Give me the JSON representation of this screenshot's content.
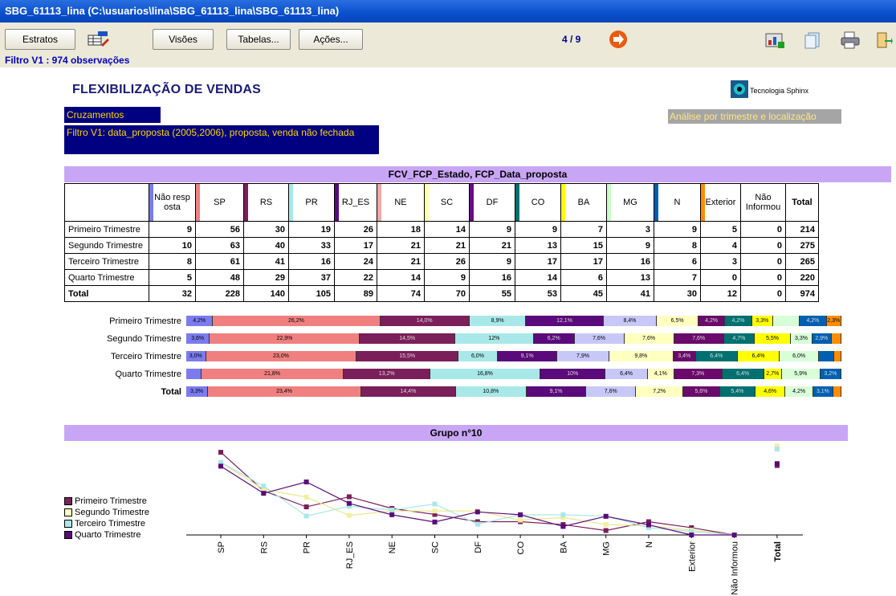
{
  "window": {
    "title": "SBG_61113_lina (C:\\usuarios\\lina\\SBG_61113_lina\\SBG_61113_lina)"
  },
  "toolbar": {
    "estratos_label": "Estratos",
    "visoes_label": "Visões",
    "tabelas_label": "Tabelas...",
    "acoes_label": "Ações...",
    "pager": "4 / 9",
    "filter_status": "Filtro V1 : 974 observações"
  },
  "header": {
    "title": "FLEXIBILIZAÇÃO DE VENDAS",
    "logo_text": "Tecnologia Sphinx",
    "cruzamentos": "Cruzamentos",
    "filter_desc": "Filtro V1: data_proposta (2005,2006), proposta, venda não fechada",
    "analysis": "Análise por trimestre e localização"
  },
  "table": {
    "title": "FCV_FCP_Estado, FCP_Data_proposta",
    "columns": [
      "Não resp osta",
      "SP",
      "RS",
      "PR",
      "RJ_ES",
      "NE",
      "SC",
      "DF",
      "CO",
      "BA",
      "MG",
      "N",
      "Exterior",
      "Não Informou",
      "Total"
    ],
    "column_colors": [
      "#7b7bef",
      "#f08080",
      "#7a1f5a",
      "#a8e8e8",
      "#5a0a7a",
      "#f0a8a8",
      "#ffffb0",
      "#6a0a8a",
      "#007070",
      "#ffff00",
      "#c8ffc8",
      "#0060b0",
      "#ff8c00",
      "",
      ""
    ],
    "rows": [
      {
        "label": "Primeiro Trimestre",
        "values": [
          "9",
          "56",
          "30",
          "19",
          "26",
          "18",
          "14",
          "9",
          "9",
          "7",
          "3",
          "9",
          "5",
          "0",
          "214"
        ]
      },
      {
        "label": "Segundo Trimestre",
        "values": [
          "10",
          "63",
          "40",
          "33",
          "17",
          "21",
          "21",
          "21",
          "13",
          "15",
          "9",
          "8",
          "4",
          "0",
          "275"
        ]
      },
      {
        "label": "Terceiro Trimestre",
        "values": [
          "8",
          "61",
          "41",
          "16",
          "24",
          "21",
          "26",
          "9",
          "17",
          "17",
          "16",
          "6",
          "3",
          "0",
          "265"
        ]
      },
      {
        "label": "Quarto Trimestre",
        "values": [
          "5",
          "48",
          "29",
          "37",
          "22",
          "14",
          "9",
          "16",
          "14",
          "6",
          "13",
          "7",
          "0",
          "0",
          "220"
        ]
      },
      {
        "label": "Total",
        "values": [
          "32",
          "228",
          "140",
          "105",
          "89",
          "74",
          "70",
          "55",
          "53",
          "45",
          "41",
          "30",
          "12",
          "0",
          "974"
        ]
      }
    ]
  },
  "stacked": {
    "rows": [
      {
        "label": "Primeiro Trimestre",
        "segments": [
          {
            "c": "#7b7bef",
            "v": 4.2,
            "t": "4,2%"
          },
          {
            "c": "#f08080",
            "v": 26.2,
            "t": "26,2%"
          },
          {
            "c": "#7a1f5a",
            "v": 14.0,
            "t": "14,0%"
          },
          {
            "c": "#a8e8e8",
            "v": 8.9,
            "t": "8,9%"
          },
          {
            "c": "#5a0a7a",
            "v": 12.1,
            "t": "12,1%"
          },
          {
            "c": "#c8c8f8",
            "v": 8.4,
            "t": "8,4%"
          },
          {
            "c": "#ffffc0",
            "v": 6.5,
            "t": "6,5%"
          },
          {
            "c": "#6a0a6a",
            "v": 4.2,
            "t": "4,2%"
          },
          {
            "c": "#007070",
            "v": 4.2,
            "t": "4,2%"
          },
          {
            "c": "#ffff00",
            "v": 3.3,
            "t": "3,3%"
          },
          {
            "c": "#d8ffd8",
            "v": 4.2,
            "t": ""
          },
          {
            "c": "#0060b0",
            "v": 4.2,
            "t": "4,2%"
          },
          {
            "c": "#ff8c00",
            "v": 2.3,
            "t": "2,3%"
          }
        ]
      },
      {
        "label": "Segundo Trimestre",
        "segments": [
          {
            "c": "#7b7bef",
            "v": 3.6,
            "t": "3,6%"
          },
          {
            "c": "#f08080",
            "v": 22.9,
            "t": "22,9%"
          },
          {
            "c": "#7a1f5a",
            "v": 14.5,
            "t": "14,5%"
          },
          {
            "c": "#a8e8e8",
            "v": 12.0,
            "t": "12%"
          },
          {
            "c": "#5a0a7a",
            "v": 6.2,
            "t": "6,2%"
          },
          {
            "c": "#c8c8f8",
            "v": 7.6,
            "t": "7,6%"
          },
          {
            "c": "#ffffc0",
            "v": 7.6,
            "t": "7,6%"
          },
          {
            "c": "#6a0a6a",
            "v": 7.6,
            "t": "7,6%"
          },
          {
            "c": "#007070",
            "v": 4.7,
            "t": "4,7%"
          },
          {
            "c": "#ffff00",
            "v": 5.5,
            "t": "5,5%"
          },
          {
            "c": "#d8ffd8",
            "v": 3.3,
            "t": "3,3%"
          },
          {
            "c": "#0060b0",
            "v": 2.9,
            "t": "2,9%"
          },
          {
            "c": "#ff8c00",
            "v": 1.5,
            "t": ""
          }
        ]
      },
      {
        "label": "Terceiro Trimestre",
        "segments": [
          {
            "c": "#7b7bef",
            "v": 3.0,
            "t": "3,0%"
          },
          {
            "c": "#f08080",
            "v": 23.0,
            "t": "23,0%"
          },
          {
            "c": "#7a1f5a",
            "v": 15.5,
            "t": "15,5%"
          },
          {
            "c": "#a8e8e8",
            "v": 6.0,
            "t": "6,0%"
          },
          {
            "c": "#5a0a7a",
            "v": 9.1,
            "t": "9,1%"
          },
          {
            "c": "#c8c8f8",
            "v": 7.9,
            "t": "7,9%"
          },
          {
            "c": "#ffffc0",
            "v": 9.8,
            "t": "9,8%"
          },
          {
            "c": "#6a0a6a",
            "v": 3.4,
            "t": "3,4%"
          },
          {
            "c": "#007070",
            "v": 6.4,
            "t": "6,4%"
          },
          {
            "c": "#ffff00",
            "v": 6.4,
            "t": "6,4%"
          },
          {
            "c": "#d8ffd8",
            "v": 6.0,
            "t": "6,0%"
          },
          {
            "c": "#0060b0",
            "v": 2.3,
            "t": ""
          },
          {
            "c": "#ff8c00",
            "v": 1.1,
            "t": ""
          }
        ]
      },
      {
        "label": "Quarto Trimestre",
        "segments": [
          {
            "c": "#7b7bef",
            "v": 2.3,
            "t": ""
          },
          {
            "c": "#f08080",
            "v": 21.8,
            "t": "21,8%"
          },
          {
            "c": "#7a1f5a",
            "v": 13.2,
            "t": "13,2%"
          },
          {
            "c": "#a8e8e8",
            "v": 16.8,
            "t": "16,8%"
          },
          {
            "c": "#5a0a7a",
            "v": 10.0,
            "t": "10%"
          },
          {
            "c": "#c8c8f8",
            "v": 6.4,
            "t": "6,4%"
          },
          {
            "c": "#ffffc0",
            "v": 4.1,
            "t": "4,1%"
          },
          {
            "c": "#6a0a6a",
            "v": 7.3,
            "t": "7,3%"
          },
          {
            "c": "#007070",
            "v": 6.4,
            "t": "6,4%"
          },
          {
            "c": "#ffff00",
            "v": 2.7,
            "t": "2,7%"
          },
          {
            "c": "#d8ffd8",
            "v": 5.9,
            "t": "5,9%"
          },
          {
            "c": "#0060b0",
            "v": 3.2,
            "t": "3,2%"
          }
        ]
      },
      {
        "label": "Total",
        "segments": [
          {
            "c": "#7b7bef",
            "v": 3.3,
            "t": "3,3%"
          },
          {
            "c": "#f08080",
            "v": 23.4,
            "t": "23,4%"
          },
          {
            "c": "#7a1f5a",
            "v": 14.4,
            "t": "14,4%"
          },
          {
            "c": "#a8e8e8",
            "v": 10.8,
            "t": "10,8%"
          },
          {
            "c": "#5a0a7a",
            "v": 9.1,
            "t": "9,1%"
          },
          {
            "c": "#c8c8f8",
            "v": 7.6,
            "t": "7,6%"
          },
          {
            "c": "#ffffc0",
            "v": 7.2,
            "t": "7,2%"
          },
          {
            "c": "#6a0a6a",
            "v": 5.6,
            "t": "5,6%"
          },
          {
            "c": "#007070",
            "v": 5.4,
            "t": "5,4%"
          },
          {
            "c": "#ffff00",
            "v": 4.6,
            "t": "4,6%"
          },
          {
            "c": "#d8ffd8",
            "v": 4.2,
            "t": "4,2%"
          },
          {
            "c": "#0060b0",
            "v": 3.1,
            "t": "3,1%"
          },
          {
            "c": "#ff8c00",
            "v": 1.2,
            "t": ""
          }
        ]
      }
    ]
  },
  "chart_data": {
    "type": "line",
    "title": "Grupo n°10",
    "categories": [
      "SP",
      "RS",
      "PR",
      "RJ_ES",
      "NE",
      "SC",
      "DF",
      "CO",
      "BA",
      "MG",
      "N",
      "Exterior",
      "Não Informou",
      "Total"
    ],
    "series": [
      {
        "name": "Primeiro Trimestre",
        "color": "#7a1f5a",
        "marker": "square",
        "values": [
          26.2,
          14.0,
          8.9,
          12.1,
          8.4,
          6.5,
          4.2,
          4.2,
          3.3,
          1.4,
          4.2,
          2.3,
          0,
          22.0
        ]
      },
      {
        "name": "Segundo Trimestre",
        "color": "#ffffc0",
        "marker": "square",
        "values": [
          22.9,
          14.5,
          12.0,
          6.2,
          7.6,
          7.6,
          7.6,
          4.7,
          5.5,
          3.3,
          2.9,
          1.5,
          0,
          28.2
        ]
      },
      {
        "name": "Terceiro Trimestre",
        "color": "#a8e8e8",
        "marker": "square",
        "values": [
          23.0,
          15.5,
          6.0,
          9.1,
          7.9,
          9.8,
          3.4,
          6.4,
          6.4,
          6.0,
          2.3,
          1.1,
          0,
          27.2
        ]
      },
      {
        "name": "Quarto Trimestre",
        "color": "#5a0a7a",
        "marker": "square",
        "values": [
          21.8,
          13.2,
          16.8,
          10.0,
          6.4,
          4.1,
          7.3,
          6.4,
          2.7,
          5.9,
          3.2,
          0,
          0,
          22.6
        ]
      }
    ]
  }
}
